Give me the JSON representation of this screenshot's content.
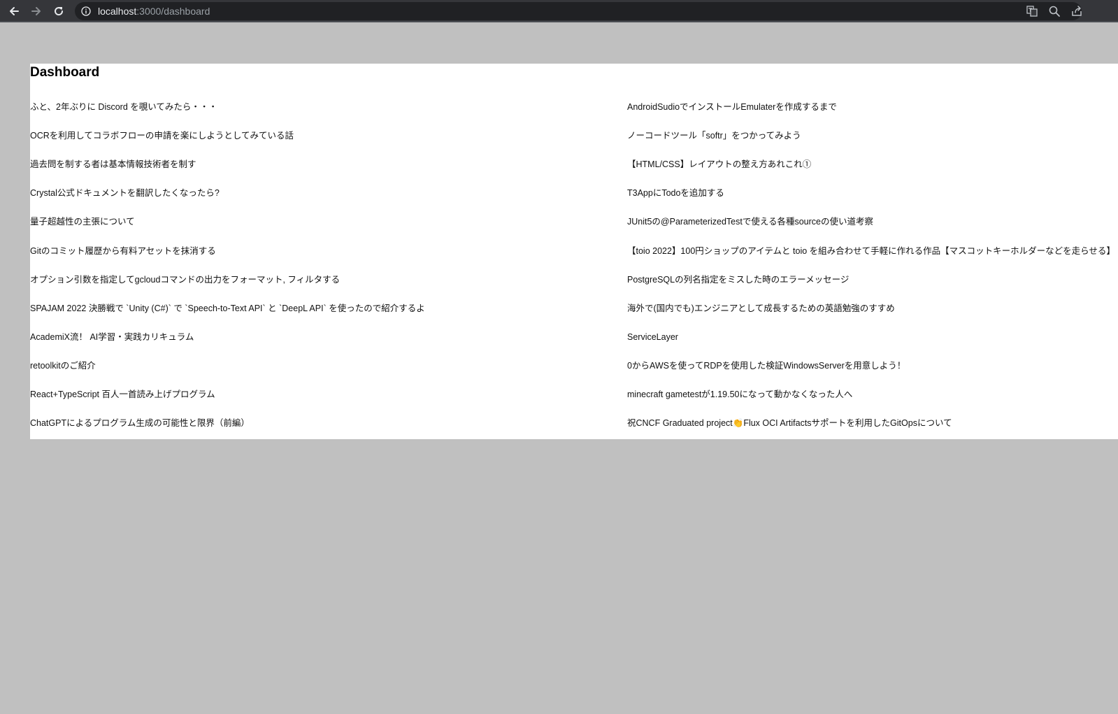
{
  "browser": {
    "url_host": "localhost",
    "url_path": ":3000/dashboard"
  },
  "page": {
    "title": "Dashboard"
  },
  "articles": {
    "left": [
      "ふと、2年ぶりに Discord を覗いてみたら・・・",
      "OCRを利用してコラボフローの申請を楽にしようとしてみている話",
      "過去問を制する者は基本情報技術者を制す",
      "Crystal公式ドキュメントを翻訳したくなったら?",
      "量子超越性の主張について",
      "Gitのコミット履歴から有料アセットを抹消する",
      "オプション引数を指定してgcloudコマンドの出力をフォーマット, フィルタする",
      "SPAJAM 2022 決勝戦で `Unity (C#)` で `Speech-to-Text API` と `DeepL API` を使ったので紹介するよ",
      "AcademiX流！ AI学習・実践カリキュラム",
      "retoolkitのご紹介",
      "React+TypeScript 百人一首読み上げプログラム",
      "ChatGPTによるプログラム生成の可能性と限界（前編）"
    ],
    "right": [
      "AndroidSudioでインストールEmulaterを作成するまで",
      "ノーコードツール「softr」をつかってみよう",
      "【HTML/CSS】レイアウトの整え方あれこれ①",
      "T3AppにTodoを追加する",
      "JUnit5の@ParameterizedTestで使える各種sourceの使い道考察",
      "【toio 2022】100円ショップのアイテムと toio を組み合わせて手軽に作れる作品【マスコットキーホルダーなどを走らせる】",
      "PostgreSQLの列名指定をミスした時のエラーメッセージ",
      "海外で(国内でも)エンジニアとして成長するための英語勉強のすすめ",
      "ServiceLayer",
      "0からAWSを使ってRDPを使用した検証WindowsServerを用意しよう！",
      "minecraft gametestが1.19.50になって動かなくなった人へ",
      "祝CNCF Graduated project👏Flux OCI Artifactsサポートを利用したGitOpsについて"
    ]
  },
  "icons": {
    "back": "back-arrow-icon",
    "forward": "forward-arrow-icon",
    "reload": "reload-icon",
    "info": "info-icon",
    "translate": "translate-icon",
    "zoom": "zoom-icon",
    "share": "share-icon"
  },
  "colors": {
    "toolbar": "#35363a",
    "omnibox": "#202124",
    "page_background": "#c0c0c0",
    "content_background": "#ffffff"
  }
}
